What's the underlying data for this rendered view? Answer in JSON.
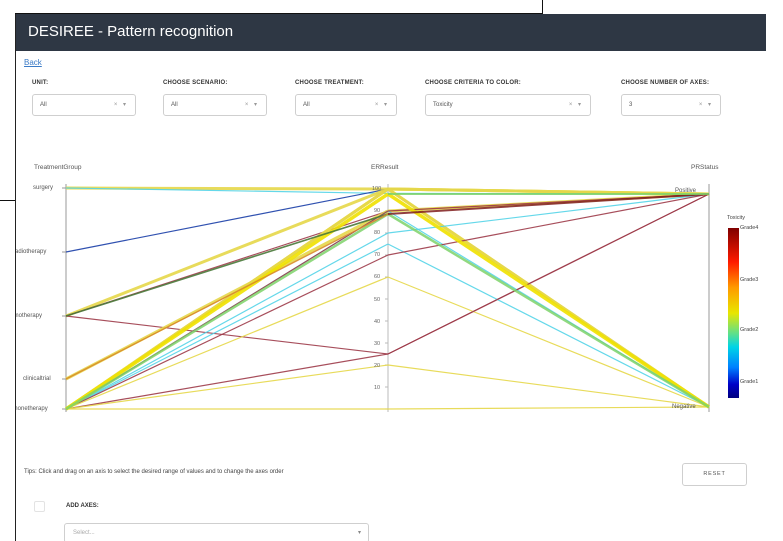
{
  "app": {
    "title": "DESIREE - Pattern recognition",
    "back_label": "Back"
  },
  "filters": [
    {
      "label": "UNIT:",
      "value": "All"
    },
    {
      "label": "CHOOSE SCENARIO:",
      "value": "All"
    },
    {
      "label": "CHOOSE TREATMENT:",
      "value": "All"
    },
    {
      "label": "CHOOSE CRITERIA TO COLOR:",
      "value": "Toxicity"
    },
    {
      "label": "CHOOSE NUMBER OF AXES:",
      "value": "3"
    }
  ],
  "select_controls": "× ▾",
  "axes": {
    "left": {
      "title": "TreatmentGroup",
      "labels": [
        "surgery",
        "radiotherapy",
        "chemotherapy",
        "clinicaltrial",
        "hormonetherapy"
      ]
    },
    "middle": {
      "title": "ERResult",
      "ticks": [
        "100",
        "90",
        "80",
        "70",
        "60",
        "50",
        "40",
        "30",
        "20",
        "10"
      ]
    },
    "right": {
      "title": "PRStatus",
      "labels": [
        "Positive",
        "Negative"
      ]
    }
  },
  "legend": {
    "title": "Toxicity",
    "grades": [
      "Grade4",
      "Grade3",
      "Grade2",
      "Grade1"
    ]
  },
  "tips": "Tips: Click and drag on an axis to select the desired range of values and to change the axes order",
  "reset_label": "RESET",
  "add_axes": {
    "label": "ADD AXES:",
    "placeholder": "Select..."
  },
  "chart_data": {
    "type": "parallel-coordinates",
    "dimensions": [
      "TreatmentGroup",
      "ERResult",
      "PRStatus"
    ],
    "color_by": "Toxicity",
    "lines": [
      {
        "TreatmentGroup": "surgery",
        "ERResult": 100,
        "PRStatus": "Positive",
        "toxicity": "Grade3"
      },
      {
        "TreatmentGroup": "surgery",
        "ERResult": 98,
        "PRStatus": "Positive",
        "toxicity": "Grade2"
      },
      {
        "TreatmentGroup": "radiotherapy",
        "ERResult": 100,
        "PRStatus": "Positive",
        "toxicity": "Grade1"
      },
      {
        "TreatmentGroup": "chemotherapy",
        "ERResult": 100,
        "PRStatus": "Positive",
        "toxicity": "Grade3"
      },
      {
        "TreatmentGroup": "chemotherapy",
        "ERResult": 90,
        "PRStatus": "Positive",
        "toxicity": "Grade4"
      },
      {
        "TreatmentGroup": "chemotherapy",
        "ERResult": 25,
        "PRStatus": "Positive",
        "toxicity": "Grade4"
      },
      {
        "TreatmentGroup": "clinicaltrial",
        "ERResult": 90,
        "PRStatus": "Positive",
        "toxicity": "Grade3"
      },
      {
        "TreatmentGroup": "hormonetherapy",
        "ERResult": 100,
        "PRStatus": "Negative",
        "toxicity": "Grade3"
      },
      {
        "TreatmentGroup": "hormonetherapy",
        "ERResult": 100,
        "PRStatus": "Negative",
        "toxicity": "Grade3"
      },
      {
        "TreatmentGroup": "hormonetherapy",
        "ERResult": 100,
        "PRStatus": "Positive",
        "toxicity": "Grade3"
      },
      {
        "TreatmentGroup": "hormonetherapy",
        "ERResult": 90,
        "PRStatus": "Negative",
        "toxicity": "Grade2"
      },
      {
        "TreatmentGroup": "hormonetherapy",
        "ERResult": 90,
        "PRStatus": "Positive",
        "toxicity": "Grade4"
      },
      {
        "TreatmentGroup": "hormonetherapy",
        "ERResult": 80,
        "PRStatus": "Positive",
        "toxicity": "Grade2"
      },
      {
        "TreatmentGroup": "hormonetherapy",
        "ERResult": 75,
        "PRStatus": "Negative",
        "toxicity": "Grade2"
      },
      {
        "TreatmentGroup": "hormonetherapy",
        "ERResult": 70,
        "PRStatus": "Positive",
        "toxicity": "Grade4"
      },
      {
        "TreatmentGroup": "hormonetherapy",
        "ERResult": 60,
        "PRStatus": "Negative",
        "toxicity": "Grade3"
      },
      {
        "TreatmentGroup": "hormonetherapy",
        "ERResult": 25,
        "PRStatus": "Positive",
        "toxicity": "Grade4"
      },
      {
        "TreatmentGroup": "hormonetherapy",
        "ERResult": 20,
        "PRStatus": "Negative",
        "toxicity": "Grade3"
      },
      {
        "TreatmentGroup": "hormonetherapy",
        "ERResult": 0,
        "PRStatus": "Negative",
        "toxicity": "Grade3"
      }
    ]
  },
  "colors": {
    "Grade1": "#1a3fa8",
    "Grade2": "#55d4e8",
    "Grade3": "#e6d84a",
    "Grade4": "#9e3b4a",
    "thick_yellow": "#f0e200",
    "thick_green": "#7ed36a",
    "dark_green": "#4a7a3a",
    "orange": "#d98a2a"
  }
}
